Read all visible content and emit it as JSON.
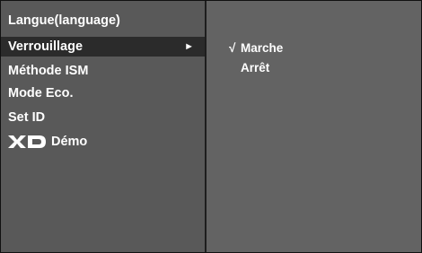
{
  "menu": {
    "items": [
      {
        "label": "Langue(language)"
      },
      {
        "label": "Verrouillage",
        "selected": true,
        "arrow": "►"
      },
      {
        "label": "Méthode ISM"
      },
      {
        "label": "Mode Eco."
      },
      {
        "label": "Set ID"
      },
      {
        "logo": "XD",
        "label": "Démo"
      }
    ]
  },
  "submenu": {
    "options": [
      {
        "check": "√",
        "label": "Marche"
      },
      {
        "check": "",
        "label": "Arrêt"
      }
    ]
  },
  "colors": {
    "panel_left": "#595959",
    "panel_right": "#636363",
    "selected_bg": "#2b2b2b",
    "text": "#ffffff"
  }
}
